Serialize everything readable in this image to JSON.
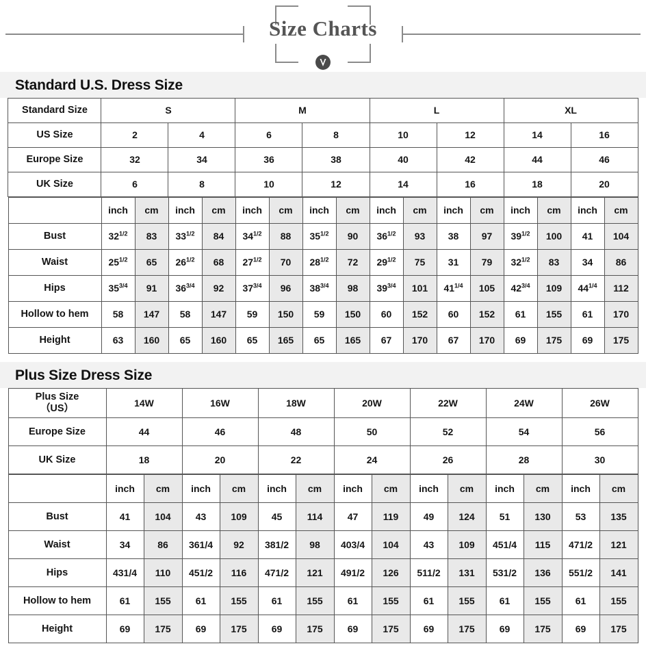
{
  "banner": {
    "title": "Size Charts",
    "ornament_icon": "shield-badge-icon",
    "rule_color": "#8a8a8a",
    "title_color": "#555555"
  },
  "sections": [
    {
      "id": "standard",
      "heading": "Standard U.S. Dress Size",
      "group_label": "Standard Size",
      "groups": [
        "S",
        "M",
        "L",
        "XL"
      ],
      "rows": [
        {
          "label": "US Size",
          "values": [
            "2",
            "4",
            "6",
            "8",
            "10",
            "12",
            "14",
            "16"
          ]
        },
        {
          "label": "Europe Size",
          "values": [
            "32",
            "34",
            "36",
            "38",
            "40",
            "42",
            "44",
            "46"
          ]
        },
        {
          "label": "UK Size",
          "values": [
            "6",
            "8",
            "10",
            "12",
            "14",
            "16",
            "18",
            "20"
          ]
        }
      ],
      "unit_headers": [
        "inch",
        "cm"
      ],
      "measurements": [
        {
          "label": "Bust",
          "inch": [
            "32 1/2",
            "33 1/2",
            "34 1/2",
            "35 1/2",
            "36 1/2",
            "38",
            "39 1/2",
            "41"
          ],
          "inch_whole": [
            "32",
            "33",
            "34",
            "35",
            "36",
            "38",
            "39",
            "41"
          ],
          "inch_frac": [
            "1/2",
            "1/2",
            "1/2",
            "1/2",
            "1/2",
            "",
            "1/2",
            ""
          ],
          "cm": [
            "83",
            "84",
            "88",
            "90",
            "93",
            "97",
            "100",
            "104"
          ]
        },
        {
          "label": "Waist",
          "inch": [
            "25 1/2",
            "26 1/2",
            "27 1/2",
            "28 1/2",
            "29 1/2",
            "31",
            "32 1/2",
            "34"
          ],
          "inch_whole": [
            "25",
            "26",
            "27",
            "28",
            "29",
            "31",
            "32",
            "34"
          ],
          "inch_frac": [
            "1/2",
            "1/2",
            "1/2",
            "1/2",
            "1/2",
            "",
            "1/2",
            ""
          ],
          "cm": [
            "65",
            "68",
            "70",
            "72",
            "75",
            "79",
            "83",
            "86"
          ]
        },
        {
          "label": "Hips",
          "inch": [
            "35 3/4",
            "36 3/4",
            "37 3/4",
            "38 3/4",
            "39 3/4",
            "41 1/4",
            "42 3/4",
            "44 1/4"
          ],
          "inch_whole": [
            "35",
            "36",
            "37",
            "38",
            "39",
            "41",
            "42",
            "44"
          ],
          "inch_frac": [
            "3/4",
            "3/4",
            "3/4",
            "3/4",
            "3/4",
            "1/4",
            "3/4",
            "1/4"
          ],
          "cm": [
            "91",
            "92",
            "96",
            "98",
            "101",
            "105",
            "109",
            "112"
          ]
        },
        {
          "label": "Hollow to hem",
          "inch": [
            "58",
            "58",
            "59",
            "59",
            "60",
            "60",
            "61",
            "61"
          ],
          "inch_whole": [
            "58",
            "58",
            "59",
            "59",
            "60",
            "60",
            "61",
            "61"
          ],
          "inch_frac": [
            "",
            "",
            "",
            "",
            "",
            "",
            "",
            ""
          ],
          "cm": [
            "147",
            "147",
            "150",
            "150",
            "152",
            "152",
            "155",
            "170"
          ]
        },
        {
          "label": "Height",
          "inch": [
            "63",
            "65",
            "65",
            "65",
            "67",
            "67",
            "69",
            "69"
          ],
          "inch_whole": [
            "63",
            "65",
            "65",
            "65",
            "67",
            "67",
            "69",
            "69"
          ],
          "inch_frac": [
            "",
            "",
            "",
            "",
            "",
            "",
            "",
            ""
          ],
          "cm": [
            "160",
            "160",
            "165",
            "165",
            "170",
            "170",
            "175",
            "175"
          ]
        }
      ]
    },
    {
      "id": "plus",
      "heading": "Plus Size Dress Size",
      "group_label_line1": "Plus Size",
      "group_label_line2": "（US）",
      "sizes": [
        "14W",
        "16W",
        "18W",
        "20W",
        "22W",
        "24W",
        "26W"
      ],
      "rows": [
        {
          "label": "Europe Size",
          "values": [
            "44",
            "46",
            "48",
            "50",
            "52",
            "54",
            "56"
          ]
        },
        {
          "label": "UK Size",
          "values": [
            "18",
            "20",
            "22",
            "24",
            "26",
            "28",
            "30"
          ]
        }
      ],
      "unit_headers": [
        "inch",
        "cm"
      ],
      "measurements": [
        {
          "label": "Bust",
          "inch": [
            "41",
            "43",
            "45",
            "47",
            "49",
            "51",
            "53"
          ],
          "cm": [
            "104",
            "109",
            "114",
            "119",
            "124",
            "130",
            "135"
          ]
        },
        {
          "label": "Waist",
          "inch": [
            "34",
            "361/4",
            "381/2",
            "403/4",
            "43",
            "451/4",
            "471/2"
          ],
          "cm": [
            "86",
            "92",
            "98",
            "104",
            "109",
            "115",
            "121"
          ]
        },
        {
          "label": "Hips",
          "inch": [
            "431/4",
            "451/2",
            "471/2",
            "491/2",
            "511/2",
            "531/2",
            "551/2"
          ],
          "cm": [
            "110",
            "116",
            "121",
            "126",
            "131",
            "136",
            "141"
          ]
        },
        {
          "label": "Hollow to hem",
          "inch": [
            "61",
            "61",
            "61",
            "61",
            "61",
            "61",
            "61"
          ],
          "cm": [
            "155",
            "155",
            "155",
            "155",
            "155",
            "155",
            "155"
          ]
        },
        {
          "label": "Height",
          "inch": [
            "69",
            "69",
            "69",
            "69",
            "69",
            "69",
            "69"
          ],
          "cm": [
            "175",
            "175",
            "175",
            "175",
            "175",
            "175",
            "175"
          ]
        }
      ]
    }
  ],
  "chart_data": {
    "type": "table",
    "title": "Size Charts",
    "tables": [
      {
        "name": "Standard U.S. Dress Size",
        "columns": [
          "S",
          "S",
          "M",
          "M",
          "L",
          "L",
          "XL",
          "XL"
        ],
        "us_size": [
          2,
          4,
          6,
          8,
          10,
          12,
          14,
          16
        ],
        "europe_size": [
          32,
          34,
          36,
          38,
          40,
          42,
          44,
          46
        ],
        "uk_size": [
          6,
          8,
          10,
          12,
          14,
          16,
          18,
          20
        ],
        "bust_inch": [
          32.5,
          33.5,
          34.5,
          35.5,
          36.5,
          38,
          39.5,
          41
        ],
        "bust_cm": [
          83,
          84,
          88,
          90,
          93,
          97,
          100,
          104
        ],
        "waist_inch": [
          25.5,
          26.5,
          27.5,
          28.5,
          29.5,
          31,
          32.5,
          34
        ],
        "waist_cm": [
          65,
          68,
          70,
          72,
          75,
          79,
          83,
          86
        ],
        "hips_inch": [
          35.75,
          36.75,
          37.75,
          38.75,
          39.75,
          41.25,
          42.75,
          44.25
        ],
        "hips_cm": [
          91,
          92,
          96,
          98,
          101,
          105,
          109,
          112
        ],
        "hollow_to_hem_inch": [
          58,
          58,
          59,
          59,
          60,
          60,
          61,
          61
        ],
        "hollow_to_hem_cm": [
          147,
          147,
          150,
          150,
          152,
          152,
          155,
          170
        ],
        "height_inch": [
          63,
          65,
          65,
          65,
          67,
          67,
          69,
          69
        ],
        "height_cm": [
          160,
          160,
          165,
          165,
          170,
          170,
          175,
          175
        ]
      },
      {
        "name": "Plus Size Dress Size",
        "columns": [
          "14W",
          "16W",
          "18W",
          "20W",
          "22W",
          "24W",
          "26W"
        ],
        "europe_size": [
          44,
          46,
          48,
          50,
          52,
          54,
          56
        ],
        "uk_size": [
          18,
          20,
          22,
          24,
          26,
          28,
          30
        ],
        "bust_inch": [
          41,
          43,
          45,
          47,
          49,
          51,
          53
        ],
        "bust_cm": [
          104,
          109,
          114,
          119,
          124,
          130,
          135
        ],
        "waist_inch": [
          34,
          36.25,
          38.5,
          40.75,
          43,
          45.25,
          47.5
        ],
        "waist_cm": [
          86,
          92,
          98,
          104,
          109,
          115,
          121
        ],
        "hips_inch": [
          43.25,
          45.5,
          47.5,
          49.5,
          51.5,
          53.5,
          55.5
        ],
        "hips_cm": [
          110,
          116,
          121,
          126,
          131,
          136,
          141
        ],
        "hollow_to_hem_inch": [
          61,
          61,
          61,
          61,
          61,
          61,
          61
        ],
        "hollow_to_hem_cm": [
          155,
          155,
          155,
          155,
          155,
          155,
          155
        ],
        "height_inch": [
          69,
          69,
          69,
          69,
          69,
          69,
          69
        ],
        "height_cm": [
          175,
          175,
          175,
          175,
          175,
          175,
          175
        ]
      }
    ]
  }
}
